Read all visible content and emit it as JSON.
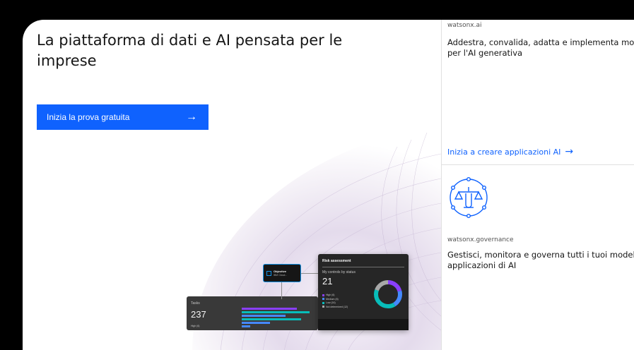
{
  "hero": {
    "title": "La piattaforma di dati e AI pensata per le imprese",
    "cta_label": "Inizia la prova gratuita",
    "cta_icon": "arrow-right-icon"
  },
  "dashboard": {
    "risk": {
      "title": "Risk assessment",
      "subtitle": "My controls by status",
      "count": "21",
      "legend": [
        {
          "label": "High (6)",
          "color": "#8a3ffc"
        },
        {
          "label": "Medium (6)",
          "color": "#4589ff"
        },
        {
          "label": "Low (16)",
          "color": "#08bdba"
        },
        {
          "label": "Not determined (12)",
          "color": "#a8a8a8"
        }
      ]
    },
    "objective": {
      "title": "Objective",
      "subtitle": "IBM Cloud..."
    },
    "tasks": {
      "title": "Tasks",
      "count": "237",
      "legend_first": "High (6)"
    }
  },
  "watsonx_ai": {
    "eyebrow": "watsonx.ai",
    "desc_line1": "Addestra, convalida, adatta e implementa modelli",
    "desc_line2": "per l'AI generativa",
    "link_label": "Inizia a creare applicazioni AI",
    "link_icon": "arrow-right-icon"
  },
  "watsonx_gov": {
    "icon": "governance-scales-icon",
    "eyebrow": "watsonx.governance",
    "desc_line1": "Gestisci, monitora e governa tutti i tuoi modelli e",
    "desc_line2": "applicazioni di AI"
  },
  "colors": {
    "primary": "#0f62fe",
    "text": "#161616",
    "icon": "#1192e8"
  }
}
